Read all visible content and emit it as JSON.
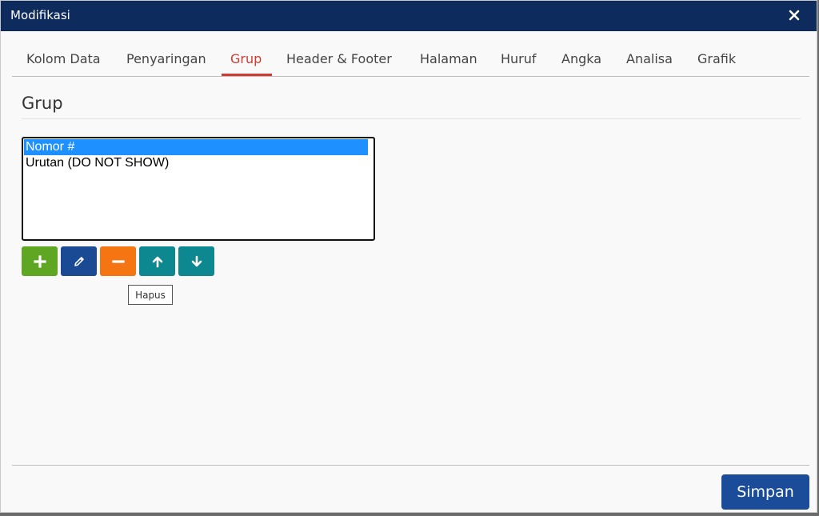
{
  "window": {
    "title": "Modifikasi",
    "close_icon": "close-icon"
  },
  "tabs": [
    {
      "label": "Kolom Data",
      "active": false
    },
    {
      "label": "Penyaringan",
      "active": false
    },
    {
      "label": "Grup",
      "active": true
    },
    {
      "label": "Header & Footer",
      "active": false
    },
    {
      "label": "Halaman",
      "active": false
    },
    {
      "label": "Huruf",
      "active": false
    },
    {
      "label": "Angka",
      "active": false
    },
    {
      "label": "Analisa",
      "active": false
    },
    {
      "label": "Grafik",
      "active": false
    }
  ],
  "section": {
    "title": "Grup"
  },
  "group_list": {
    "items": [
      {
        "label": "Nomor #",
        "selected": true
      },
      {
        "label": "Urutan (DO NOT SHOW)",
        "selected": false
      }
    ]
  },
  "toolbar": {
    "add_icon": "plus-icon",
    "edit_icon": "pencil-icon",
    "remove_icon": "minus-icon",
    "up_icon": "arrow-up-icon",
    "down_icon": "arrow-down-icon"
  },
  "tooltip": {
    "text": "Hapus"
  },
  "footer": {
    "save_label": "Simpan"
  },
  "colors": {
    "titlebar": "#0d2b5c",
    "active_tab": "#d13a2f",
    "add": "#5fa622",
    "edit": "#1b4a94",
    "remove": "#f47512",
    "move": "#0e8890",
    "save": "#1a4c9a",
    "selection": "#1e90ff"
  }
}
